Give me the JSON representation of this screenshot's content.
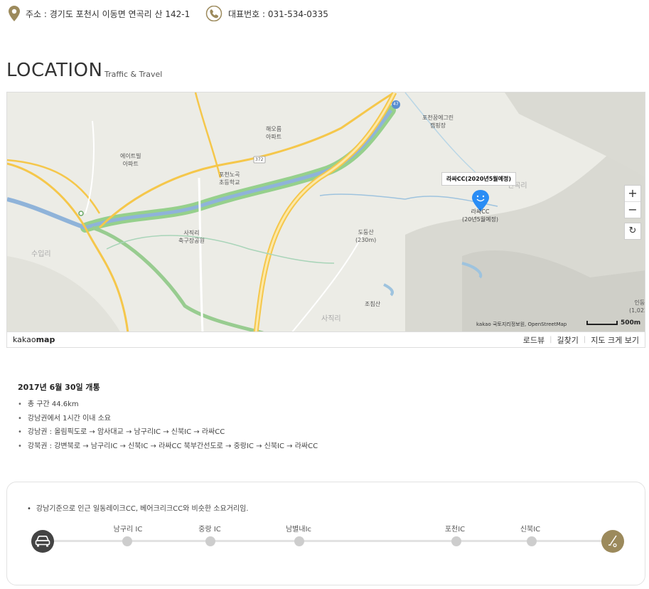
{
  "contact": {
    "address": "주소 : 경기도 포천시 이동면 연곡리 산 142-1",
    "phone": "대표번호 : 031-534-0335"
  },
  "heading": {
    "title": "LOCATION",
    "subtitle": "Traffic & Travel"
  },
  "map": {
    "callout": "라싸CC(2020년5월예정)",
    "marker_label": "라싸CC",
    "marker_sublabel": "(20년5월예정)",
    "labels": {
      "apt1": "에이트빌",
      "apt1b": "아파트",
      "apt2": "해오름",
      "apt2b": "아파트",
      "school": "포천노곡",
      "schoolb": "초등학교",
      "camp": "포천꿈에그린",
      "campb": "캠핑장",
      "park": "사직리",
      "parkb": "축구장공원",
      "mtn1": "도둥산",
      "mtn1b": "(230m)",
      "mtn2": "조침산",
      "village1": "수입리",
      "village2": "사직리",
      "village3": "연곡리",
      "village4": "인둥산",
      "village4b": "(1,023m)",
      "route372": "372",
      "route47": "47"
    },
    "attribution": "kakao 국토지리정보원, OpenStreetMap",
    "scale": "500m",
    "zoom_in": "+",
    "zoom_out": "−",
    "refresh": "↻"
  },
  "map_footer": {
    "logo_bold": "kakao",
    "logo_rest": "map",
    "links": [
      "로드뷰",
      "길찾기",
      "지도 크게 보기"
    ]
  },
  "route": {
    "open_date": "2017년 6월 30일 개통",
    "items": [
      "총 구간 44.6km",
      "강남권에서 1시간 이내 소요",
      "강남권 : 올림픽도로 → 암사대교 → 남구리IC → 신북IC → 라싸CC",
      "강북권 : 강변북로 → 남구리IC → 신북IC → 라싸CC 북부간선도로 → 중랑IC → 신북IC → 라싸CC"
    ]
  },
  "route_box": {
    "note": "강남기준으로 인근 일동레이크CC, 베어크리크CC와 비슷한 소요거리임.",
    "stops": [
      "남구리 IC",
      "중랑 IC",
      "남별내Ic",
      "포천IC",
      "신북IC"
    ],
    "start_icon": "car-icon",
    "end_icon": "golf-icon"
  },
  "colors": {
    "accent_gold": "#9c8a5c",
    "car_dark": "#444444",
    "track": "#e2e2e2",
    "dot": "#cdcdcd",
    "map_road": "#f5c74b",
    "map_river": "#8fb3d9",
    "map_green": "#8fcf8a",
    "marker_blue": "#2a8df5"
  }
}
